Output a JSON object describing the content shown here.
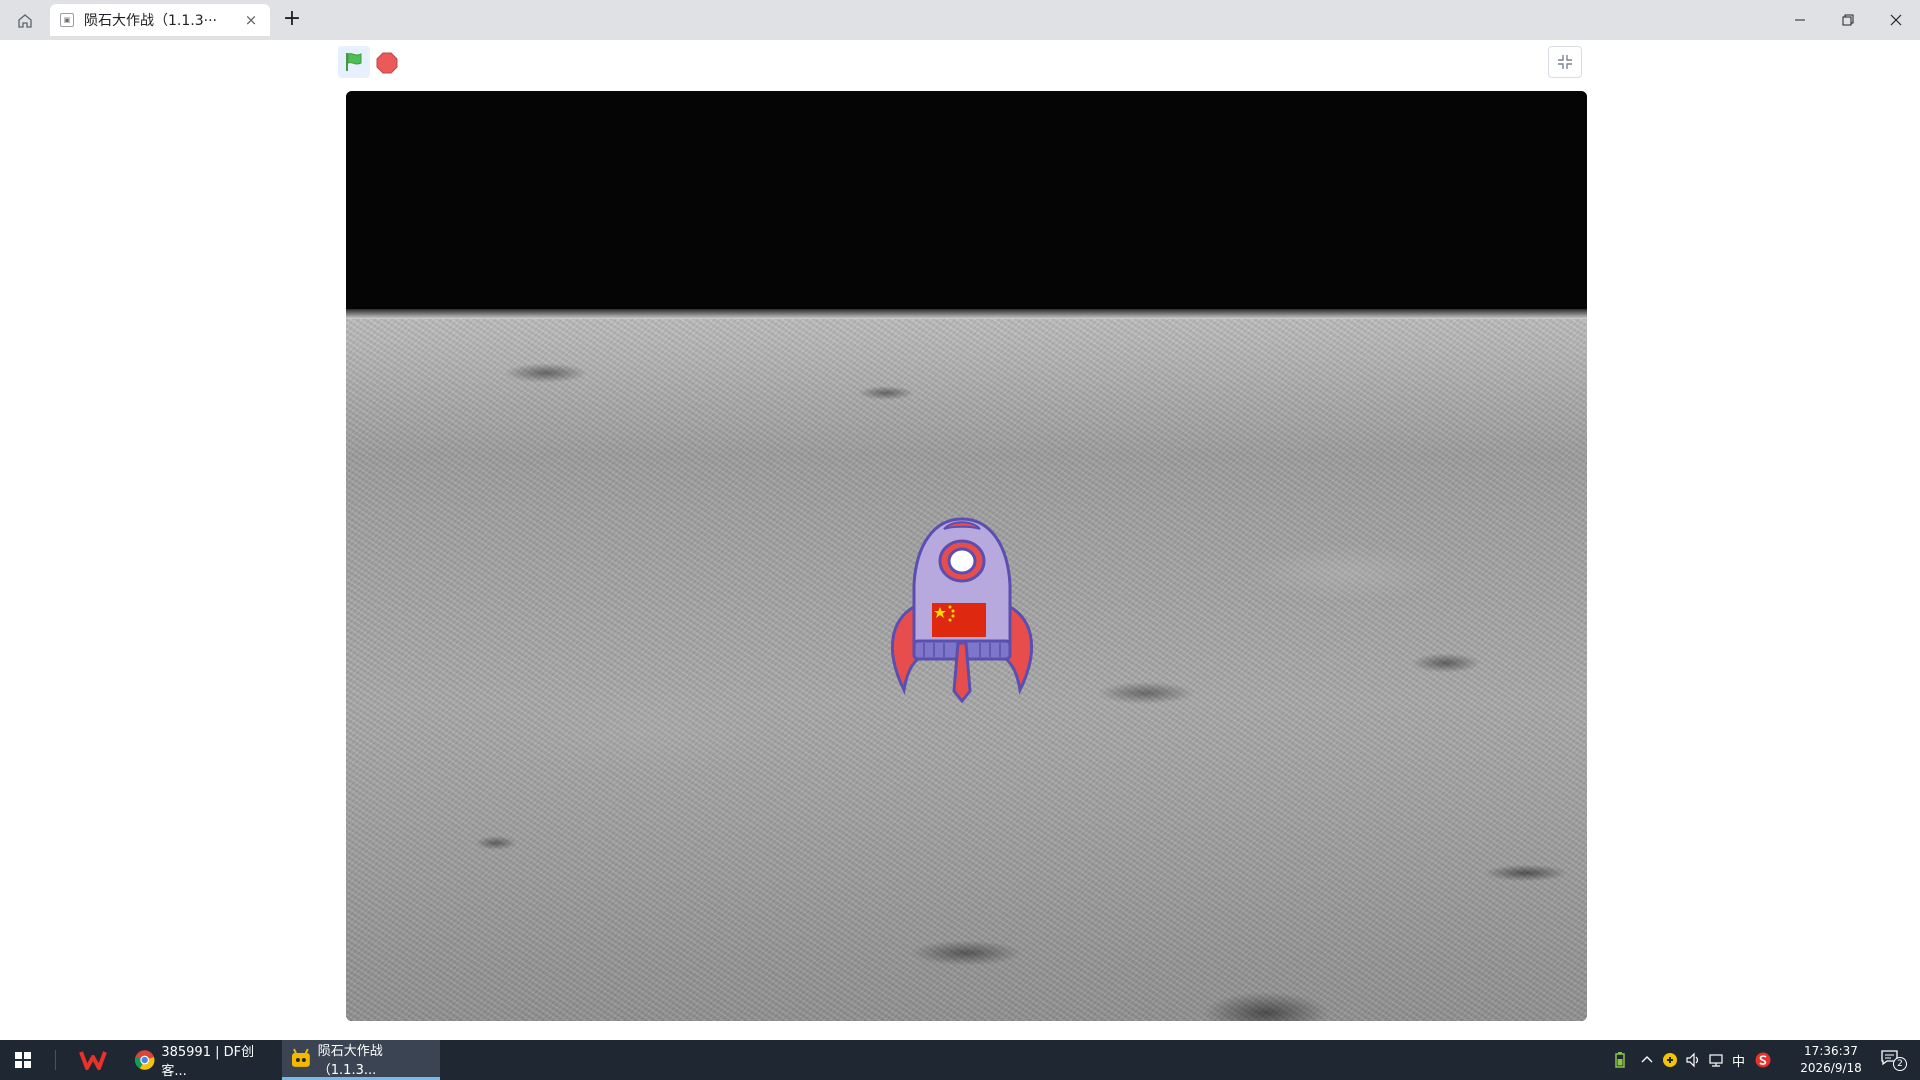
{
  "browser": {
    "tab_title": "陨石大作战（1.1.3···",
    "tab_close": "×",
    "new_tab": "+",
    "window_controls": {
      "minimize": "—",
      "restore": "❐",
      "close": "✕"
    }
  },
  "stage_toolbar": {
    "icons": {
      "green_flag": "green-flag-icon",
      "stop": "stop-icon",
      "fullscreen": "exit-fullscreen-icon"
    },
    "colors": {
      "flag": "#4cbf56",
      "stop": "#ec5959"
    }
  },
  "stage": {
    "background": "lunar-surface",
    "sprite": "rocket-with-chinese-flag"
  },
  "taskbar": {
    "apps": [
      {
        "label": "385991 | DF创客...",
        "icon": "chrome-icon"
      },
      {
        "label": "陨石大作战（1.1.3...",
        "icon": "mind-plus-icon"
      }
    ],
    "tray": {
      "ime": "中"
    },
    "clock": {
      "time": "17:36:37",
      "date": "2026/9/18"
    },
    "notifications_count": "2"
  }
}
